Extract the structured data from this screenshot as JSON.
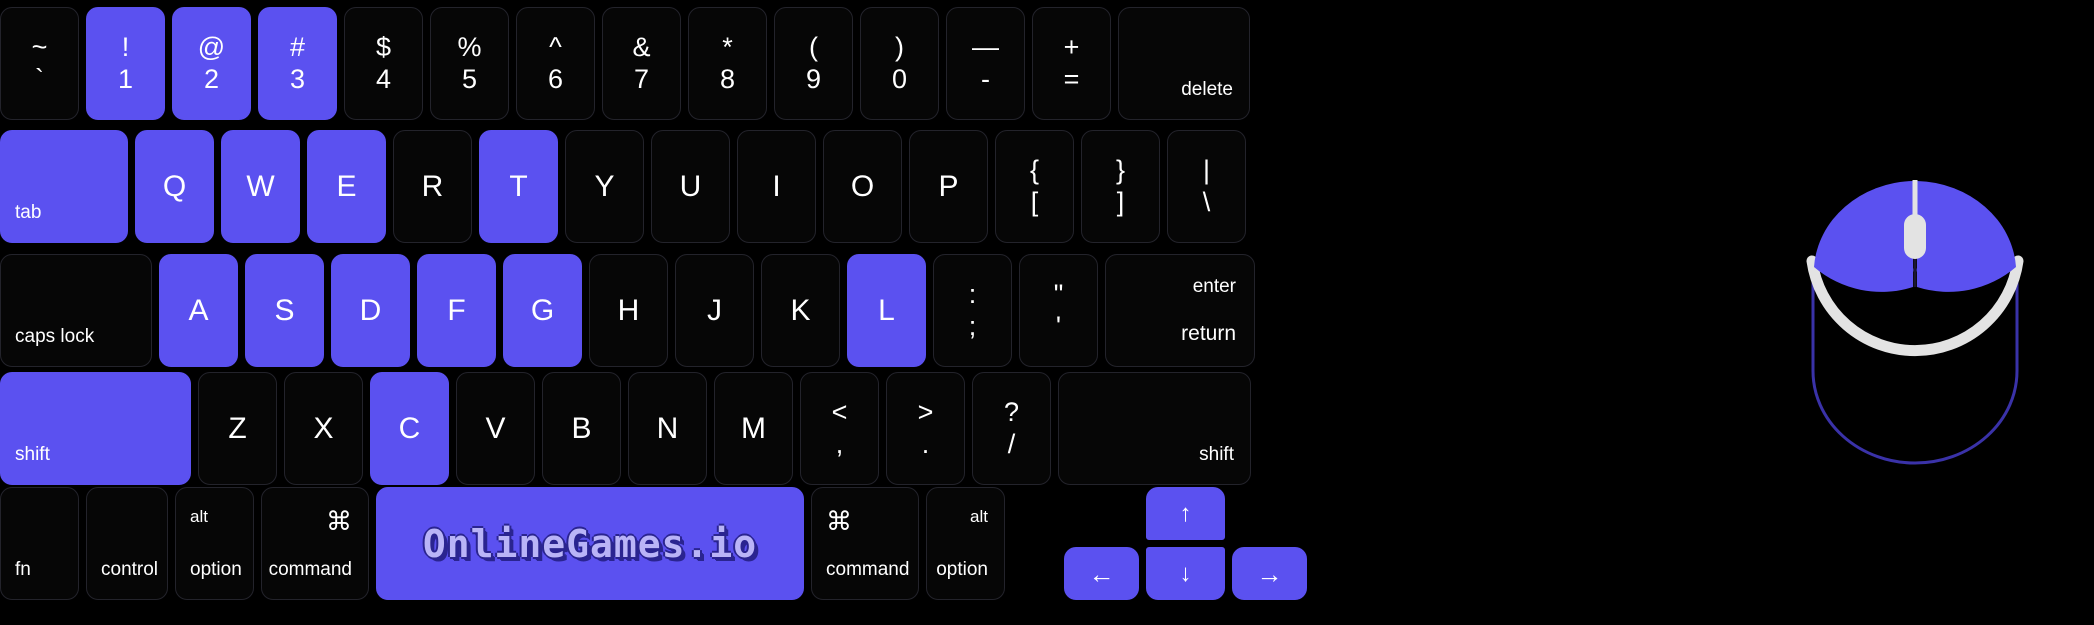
{
  "theme": {
    "background": "#000000",
    "key_bg": "#060606",
    "key_border": "#23232b",
    "highlight": "#5b51f0",
    "text": "#ffffff",
    "logo_fill": "#b9b4f7",
    "logo_shadow": "#2a2490",
    "mouse_light": "#e3e3e3",
    "mouse_outline": "#3a32a8"
  },
  "keyboard": {
    "rows": [
      {
        "name": "number-row",
        "keys": [
          {
            "name": "backtick",
            "upper": "~",
            "lower": "`",
            "highlighted": false
          },
          {
            "name": "one",
            "upper": "!",
            "lower": "1",
            "highlighted": true
          },
          {
            "name": "two",
            "upper": "@",
            "lower": "2",
            "highlighted": true
          },
          {
            "name": "three",
            "upper": "#",
            "lower": "3",
            "highlighted": true
          },
          {
            "name": "four",
            "upper": "$",
            "lower": "4",
            "highlighted": false
          },
          {
            "name": "five",
            "upper": "%",
            "lower": "5",
            "highlighted": false
          },
          {
            "name": "six",
            "upper": "^",
            "lower": "6",
            "highlighted": false
          },
          {
            "name": "seven",
            "upper": "&",
            "lower": "7",
            "highlighted": false
          },
          {
            "name": "eight",
            "upper": "*",
            "lower": "8",
            "highlighted": false
          },
          {
            "name": "nine",
            "upper": "(",
            "lower": "9",
            "highlighted": false
          },
          {
            "name": "zero",
            "upper": ")",
            "lower": "0",
            "highlighted": false
          },
          {
            "name": "minus",
            "upper": "—",
            "lower": "-",
            "highlighted": false
          },
          {
            "name": "equals",
            "upper": "+",
            "lower": "=",
            "highlighted": false
          },
          {
            "name": "delete",
            "label": "delete",
            "highlighted": false
          }
        ]
      },
      {
        "name": "top-letter-row",
        "keys": [
          {
            "name": "tab",
            "label": "tab",
            "highlighted": true
          },
          {
            "name": "q",
            "label": "Q",
            "highlighted": true
          },
          {
            "name": "w",
            "label": "W",
            "highlighted": true
          },
          {
            "name": "e",
            "label": "E",
            "highlighted": true
          },
          {
            "name": "r",
            "label": "R",
            "highlighted": false
          },
          {
            "name": "t",
            "label": "T",
            "highlighted": true
          },
          {
            "name": "y",
            "label": "Y",
            "highlighted": false
          },
          {
            "name": "u",
            "label": "U",
            "highlighted": false
          },
          {
            "name": "i",
            "label": "I",
            "highlighted": false
          },
          {
            "name": "o",
            "label": "O",
            "highlighted": false
          },
          {
            "name": "p",
            "label": "P",
            "highlighted": false
          },
          {
            "name": "bracket-left",
            "upper": "{",
            "lower": "[",
            "highlighted": false
          },
          {
            "name": "bracket-right",
            "upper": "}",
            "lower": "]",
            "highlighted": false
          },
          {
            "name": "backslash",
            "upper": "|",
            "lower": "\\",
            "highlighted": false
          }
        ]
      },
      {
        "name": "home-row",
        "keys": [
          {
            "name": "caps-lock",
            "label": "caps lock",
            "highlighted": false
          },
          {
            "name": "a",
            "label": "A",
            "highlighted": true
          },
          {
            "name": "s",
            "label": "S",
            "highlighted": true
          },
          {
            "name": "d",
            "label": "D",
            "highlighted": true
          },
          {
            "name": "f",
            "label": "F",
            "highlighted": true
          },
          {
            "name": "g",
            "label": "G",
            "highlighted": true
          },
          {
            "name": "h",
            "label": "H",
            "highlighted": false
          },
          {
            "name": "j",
            "label": "J",
            "highlighted": false
          },
          {
            "name": "k",
            "label": "K",
            "highlighted": false
          },
          {
            "name": "l",
            "label": "L",
            "highlighted": true
          },
          {
            "name": "semicolon",
            "upper": ":",
            "lower": ";",
            "highlighted": false
          },
          {
            "name": "quote",
            "upper": "\"",
            "lower": "'",
            "highlighted": false
          },
          {
            "name": "return",
            "label_top": "enter",
            "label_bottom": "return",
            "highlighted": false
          }
        ]
      },
      {
        "name": "bottom-letter-row",
        "keys": [
          {
            "name": "shift-left",
            "label": "shift",
            "highlighted": true
          },
          {
            "name": "z",
            "label": "Z",
            "highlighted": false
          },
          {
            "name": "x",
            "label": "X",
            "highlighted": false
          },
          {
            "name": "c",
            "label": "C",
            "highlighted": true
          },
          {
            "name": "v",
            "label": "V",
            "highlighted": false
          },
          {
            "name": "b",
            "label": "B",
            "highlighted": false
          },
          {
            "name": "n",
            "label": "N",
            "highlighted": false
          },
          {
            "name": "m",
            "label": "M",
            "highlighted": false
          },
          {
            "name": "comma",
            "upper": "<",
            "lower": ",",
            "highlighted": false
          },
          {
            "name": "period",
            "upper": ">",
            "lower": ".",
            "highlighted": false
          },
          {
            "name": "slash",
            "upper": "?",
            "lower": "/",
            "highlighted": false
          },
          {
            "name": "shift-right",
            "label": "shift",
            "highlighted": false
          }
        ]
      },
      {
        "name": "modifier-row",
        "keys": [
          {
            "name": "fn",
            "label": "fn",
            "highlighted": false
          },
          {
            "name": "control",
            "label": "control",
            "highlighted": false
          },
          {
            "name": "option-left",
            "label_top": "alt",
            "label": "option",
            "highlighted": false
          },
          {
            "name": "command-left",
            "glyph": "⌘",
            "label": "command",
            "highlighted": false
          },
          {
            "name": "space",
            "logo": "OnlineGames.io",
            "highlighted": true
          },
          {
            "name": "command-right",
            "glyph": "⌘",
            "label": "command",
            "highlighted": false
          },
          {
            "name": "option-right",
            "label_top": "alt",
            "label": "option",
            "highlighted": false
          },
          {
            "name": "arrow-left",
            "glyph": "←",
            "highlighted": true
          },
          {
            "name": "arrow-up",
            "glyph": "↑",
            "highlighted": true
          },
          {
            "name": "arrow-down",
            "glyph": "↓",
            "highlighted": true
          },
          {
            "name": "arrow-right",
            "glyph": "→",
            "highlighted": true
          }
        ]
      }
    ]
  },
  "mouse": {
    "name": "mouse-diagram",
    "left_button_highlighted": true,
    "right_button_highlighted": true,
    "scroll_wheel_highlighted": false,
    "body_highlighted": false
  }
}
